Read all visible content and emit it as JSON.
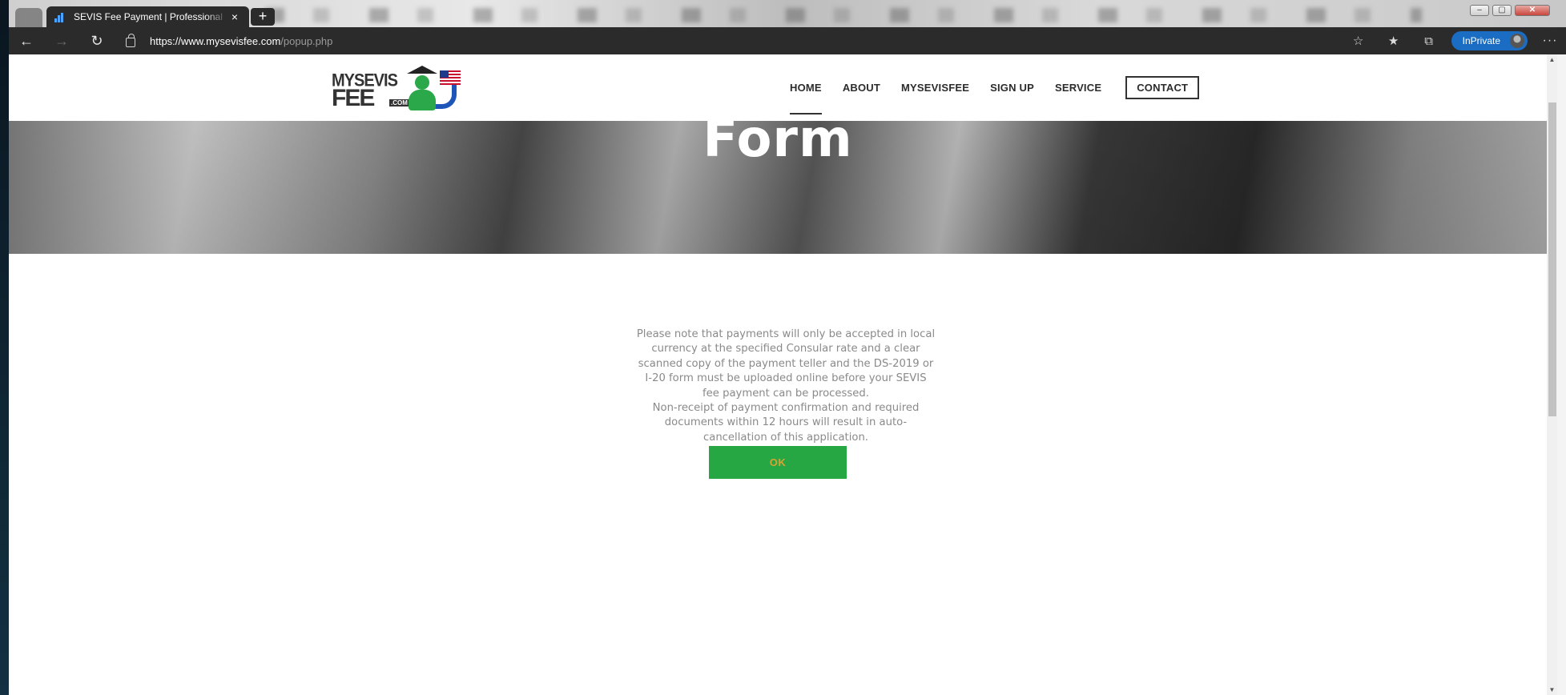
{
  "browser": {
    "tab_title": "SEVIS Fee Payment | Professional",
    "tab_close": "×",
    "new_tab": "+",
    "url_host": "https://www.mysevisfee.com",
    "url_path": "/popup.php",
    "inprivate_label": "InPrivate",
    "more_label": "···",
    "window_min": "–",
    "window_max": "▢",
    "window_close": "✕"
  },
  "site": {
    "logo": {
      "line1": "MYSEVIS",
      "line2": "FEE",
      "com": ".COM"
    },
    "nav": [
      "HOME",
      "ABOUT",
      "MYSEVISFEE",
      "SIGN UP",
      "SERVICE",
      "CONTACT"
    ],
    "active_nav": "HOME"
  },
  "hero": {
    "title": "Form"
  },
  "notice": {
    "paragraph1": "Please note that payments will only be accepted in local currency at the specified Consular rate and a clear scanned copy of the payment teller and the DS-2019 or I-20 form must be uploaded online before your SEVIS fee payment can be processed.",
    "paragraph2": "Non-receipt of payment confirmation and required documents within 12 hours will result in auto-cancellation of this application.",
    "ok_label": "OK"
  },
  "colors": {
    "ok_button_bg": "#27a644",
    "ok_button_text": "#d9a436",
    "inprivate_badge": "#1a6dc2"
  }
}
